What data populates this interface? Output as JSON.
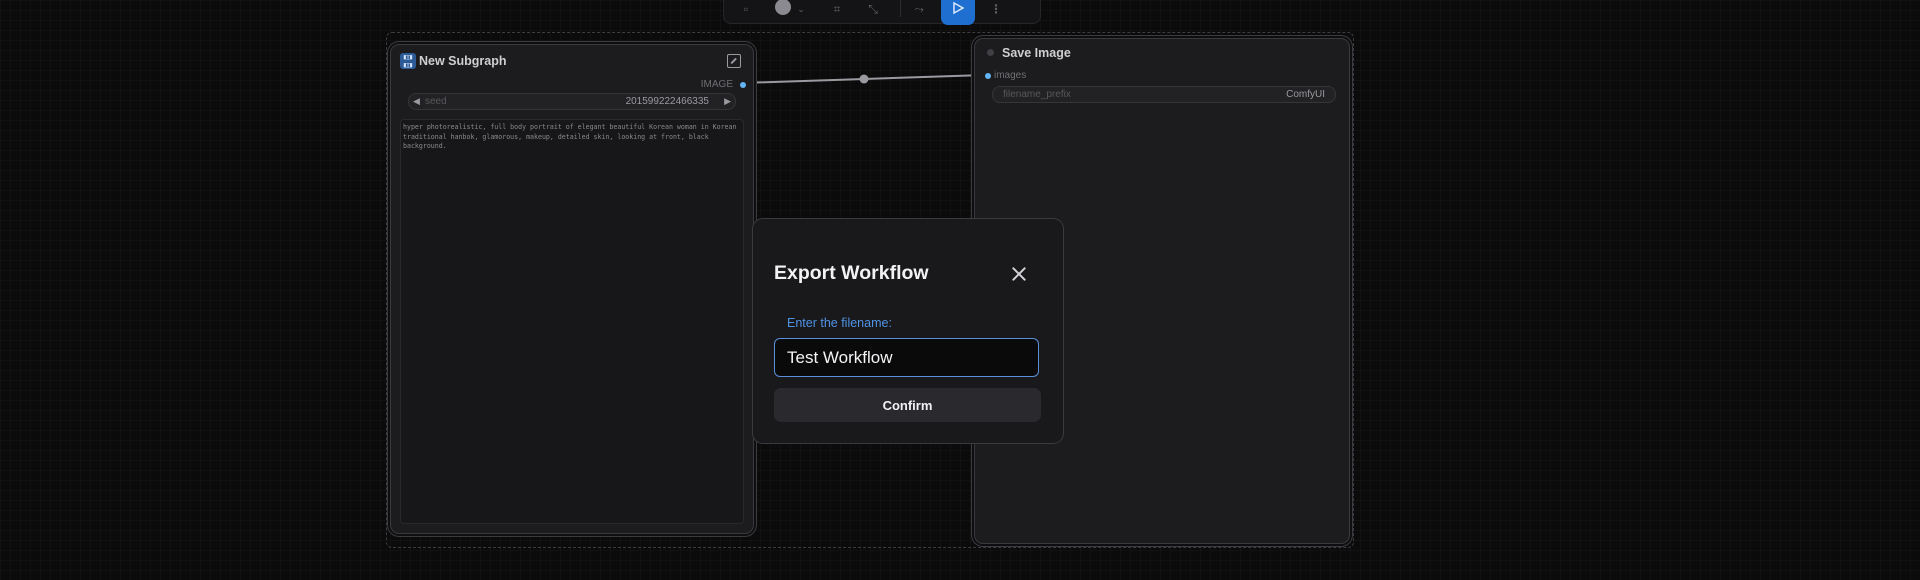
{
  "subgraph_node": {
    "title": "New Subgraph",
    "output_label": "IMAGE",
    "seed_widget": {
      "label": "seed",
      "value": "201599222466335"
    },
    "prompt_text": "hyper photorealistic, full body portrait of elegant beautiful Korean woman in Korean traditional hanbok, glamorous, makeup, detailed skin, looking at front, black background."
  },
  "save_image_node": {
    "title": "Save Image",
    "input_label": "images",
    "filename_widget": {
      "label": "filename_prefix",
      "value": "ComfyUI"
    }
  },
  "export_dialog": {
    "title": "Export Workflow",
    "field_label": "Enter the filename:",
    "filename_value": "Test Workflow",
    "confirm_label": "Confirm"
  },
  "icons": {
    "subgraph": "subgraph-icon",
    "expand": "expand-icon",
    "close": "close-icon",
    "run": "play-icon"
  },
  "colors": {
    "accent": "#4f93e6",
    "run_button": "#1f6fd1",
    "socket": "#64b5f6"
  }
}
